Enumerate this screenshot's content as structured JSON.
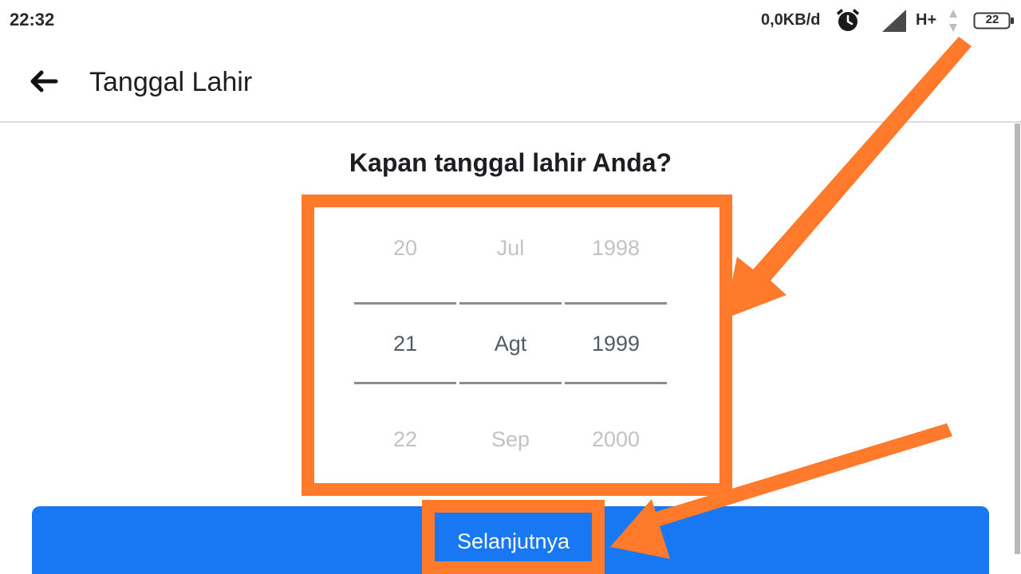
{
  "status_bar": {
    "time": "22:32",
    "net_speed": "0,0KB/d",
    "network_type": "H+",
    "battery_level": "22",
    "icons": [
      "alarm-icon",
      "signal-icon",
      "data-arrows-icon",
      "battery-icon"
    ]
  },
  "app_bar": {
    "back_icon": "arrow-left-icon",
    "title": "Tanggal Lahir"
  },
  "form": {
    "question": "Kapan tanggal lahir Anda?",
    "picker": {
      "day": {
        "prev": "20",
        "selected": "21",
        "next": "22"
      },
      "month": {
        "prev": "Jul",
        "selected": "Agt",
        "next": "Sep"
      },
      "year": {
        "prev": "1998",
        "selected": "1999",
        "next": "2000"
      }
    },
    "next_button_label": "Selanjutnya"
  },
  "colors": {
    "primary_button": "#1877f2",
    "annotation": "#ff7a2a",
    "text_dark": "#1c1e21",
    "wheel_muted": "#c0c2c6"
  }
}
